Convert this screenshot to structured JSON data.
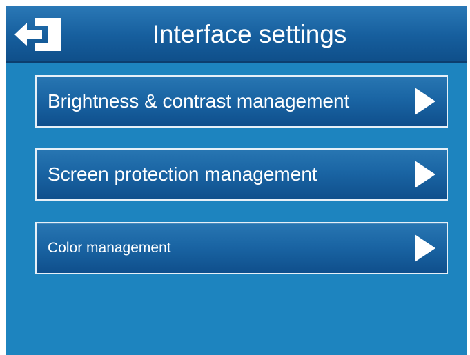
{
  "header": {
    "title": "Interface settings",
    "back_icon": "exit-arrow-icon"
  },
  "menu": {
    "items": [
      {
        "label": "Brightness & contrast management",
        "icon": "chevron-right-icon"
      },
      {
        "label": "Screen protection management",
        "icon": "chevron-right-icon"
      },
      {
        "label": "Color management",
        "icon": "chevron-right-icon"
      }
    ]
  },
  "colors": {
    "background": "#1d84bf",
    "header": "#165e9d",
    "button": "#1a65a4",
    "text": "#ffffff"
  }
}
